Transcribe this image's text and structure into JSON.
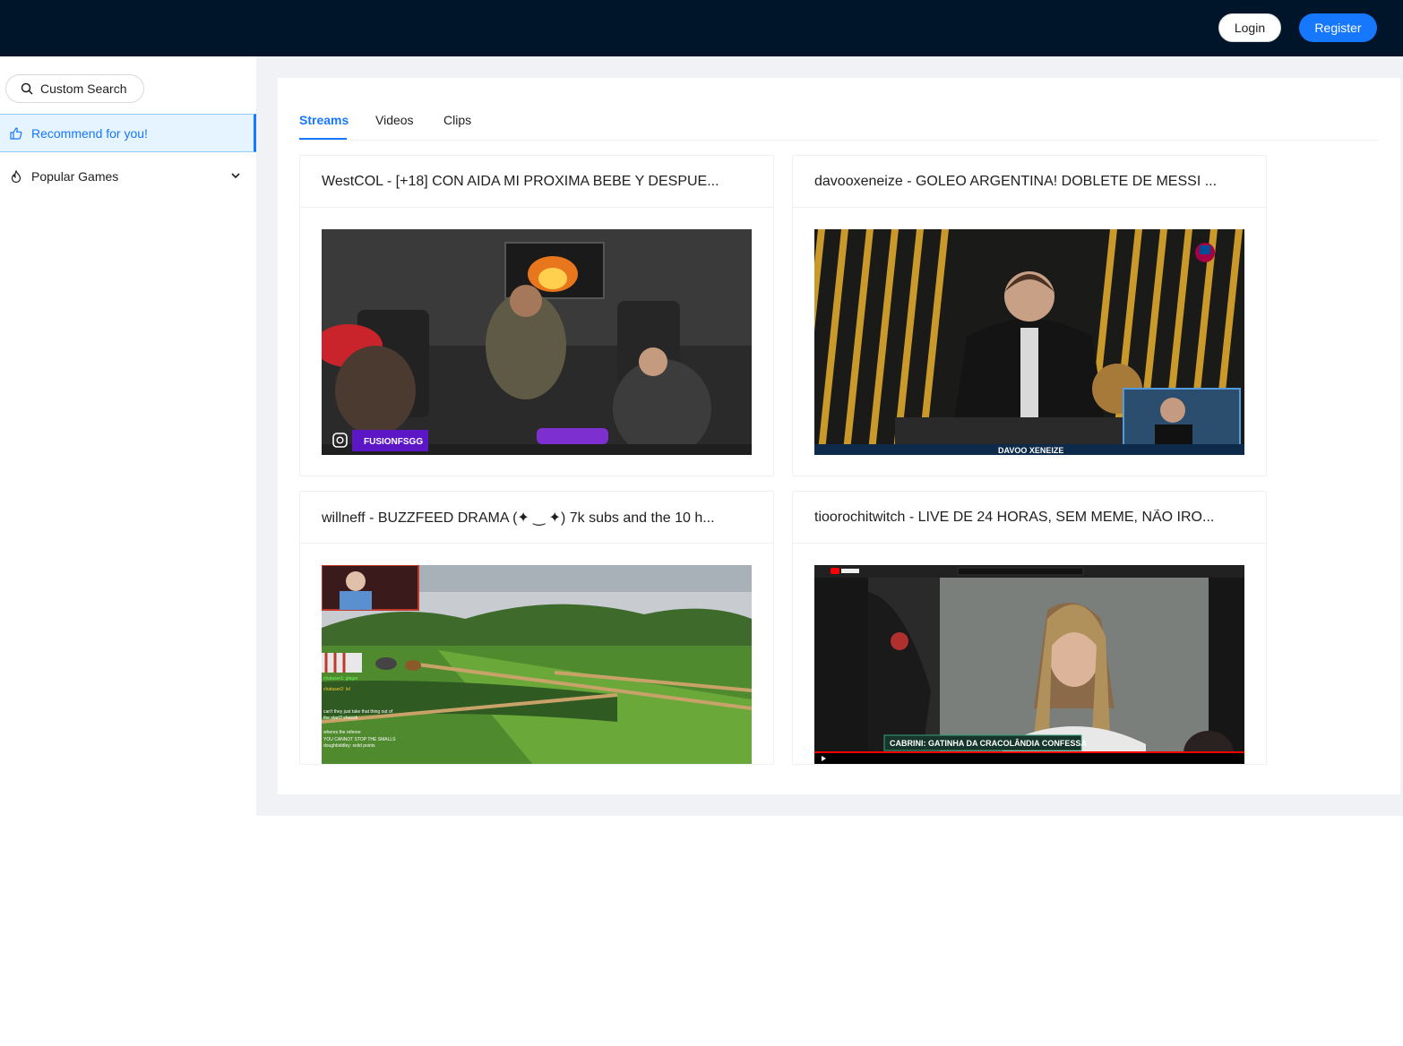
{
  "header": {
    "login_label": "Login",
    "register_label": "Register"
  },
  "sidebar": {
    "search_label": "Custom Search",
    "items": [
      {
        "label": "Recommend for you!",
        "icon": "like-icon",
        "selected": true
      },
      {
        "label": "Popular Games",
        "icon": "fire-icon",
        "expandable": true
      }
    ]
  },
  "tabs": [
    {
      "label": "Streams",
      "active": true
    },
    {
      "label": "Videos",
      "active": false
    },
    {
      "label": "Clips",
      "active": false
    }
  ],
  "cards": [
    {
      "title": "WestCOL - [+18] CON AIDA MI PROXIMA BEBE Y DESPUE...",
      "thumb_text": "FUSIONFSGG"
    },
    {
      "title": "davooxeneize - GOLEO ARGENTINA! DOBLETE DE MESSI ...",
      "thumb_text": "DAVOO XENEIZE"
    },
    {
      "title": "willneff - BUZZFEED DRAMA (✦ ‿ ✦) 7k subs and the 10 h...",
      "thumb_text": "YOU CANNOT STOP THE SMALLS"
    },
    {
      "title": "tioorochitwitch - LIVE DE 24 HORAS, SEM MEME, NÃO IRO...",
      "thumb_text": "CABRINI: GATINHA DA CRACOLÂNDIA CONFESSA"
    }
  ],
  "colors": {
    "topbar": "#001529",
    "accent": "#1677ff",
    "content_bg": "#f0f2f5"
  }
}
